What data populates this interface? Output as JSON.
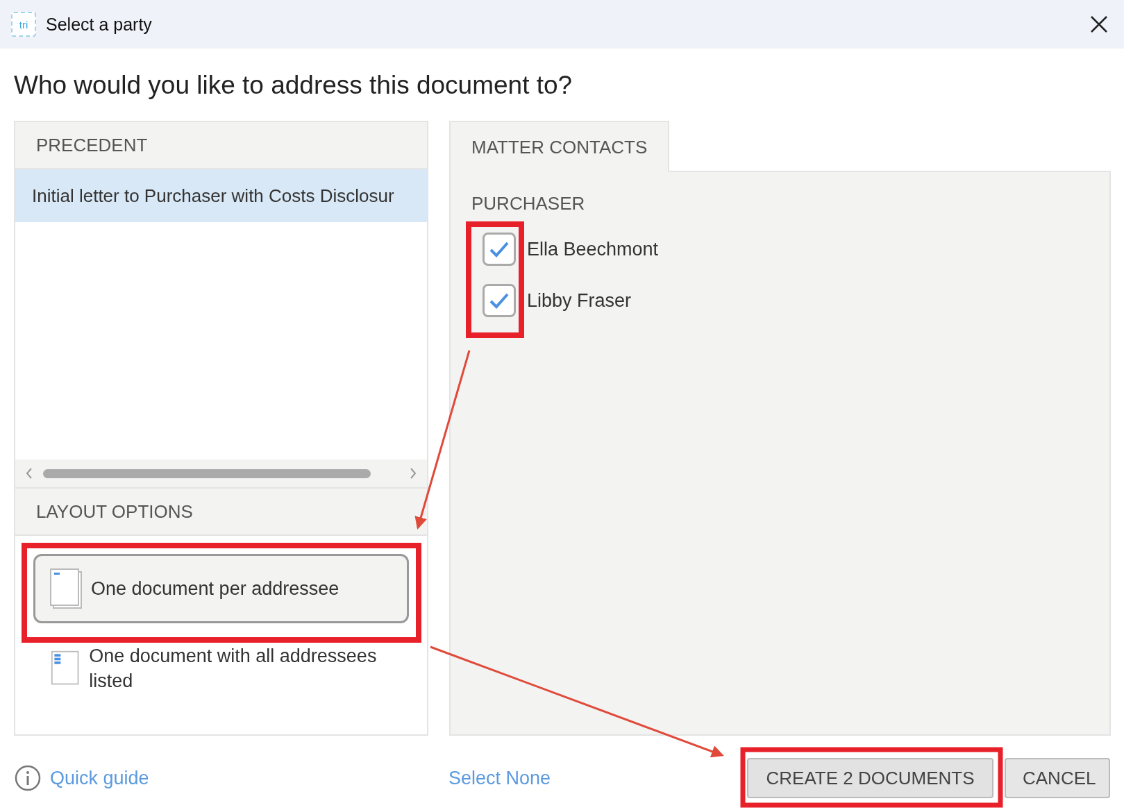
{
  "window": {
    "title": "Select a party",
    "app_icon_text": "tri"
  },
  "heading": "Who would you like to address this document to?",
  "precedent": {
    "header": "PRECEDENT",
    "items": [
      {
        "label": "Initial letter to Purchaser with Costs Disclosur",
        "selected": true
      }
    ]
  },
  "layout_options": {
    "header": "LAYOUT OPTIONS",
    "options": [
      {
        "label": "One document per addressee",
        "kind": "per",
        "selected": true
      },
      {
        "label": "One document with all addressees listed",
        "kind": "all",
        "selected": false
      }
    ]
  },
  "tabs": [
    {
      "label": "MATTER CONTACTS",
      "selected": true
    }
  ],
  "contacts": {
    "group": "PURCHASER",
    "items": [
      {
        "name": "Ella Beechmont",
        "checked": true
      },
      {
        "name": "Libby Fraser",
        "checked": true
      }
    ]
  },
  "footer": {
    "help_link": "Quick guide",
    "select_link": "Select None",
    "buttons": [
      {
        "label": "CREATE 2 DOCUMENTS",
        "kind": "primary"
      },
      {
        "label": "CANCEL",
        "kind": "secondary"
      }
    ]
  }
}
